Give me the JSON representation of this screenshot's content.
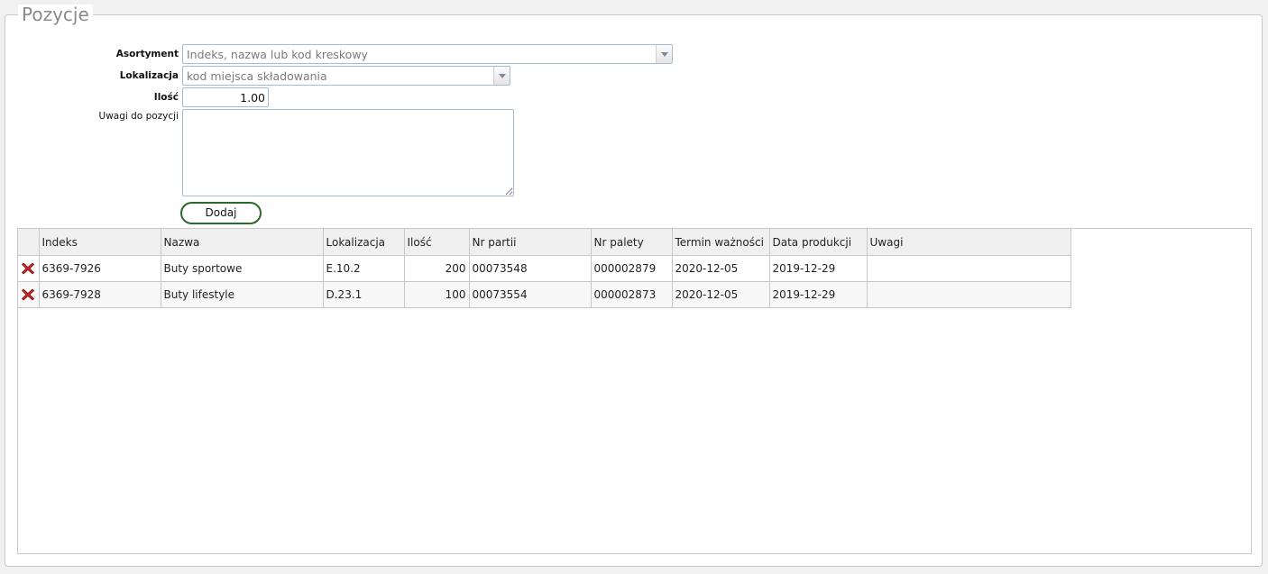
{
  "section": {
    "title": "Pozycje"
  },
  "form": {
    "asortyment_label": "Asortyment",
    "asortyment_placeholder": "Indeks, nazwa lub kod kreskowy",
    "lokalizacja_label": "Lokalizacja",
    "lokalizacja_placeholder": "kod miejsca składowania",
    "ilosc_label": "Ilość",
    "ilosc_value": "1.00",
    "uwagi_label": "Uwagi do pozycji",
    "add_button": "Dodaj"
  },
  "table": {
    "columns": [
      "Indeks",
      "Nazwa",
      "Lokalizacja",
      "Ilość",
      "Nr partii",
      "Nr palety",
      "Termin ważności",
      "Data produkcji",
      "Uwagi"
    ],
    "rows": [
      {
        "indeks": "6369-7926",
        "nazwa": "Buty sportowe",
        "lokalizacja": "E.10.2",
        "ilosc": "200",
        "nr_partii": "00073548",
        "nr_palety": "000002879",
        "termin": "2020-12-05",
        "data_produkcji": "2019-12-29",
        "uwagi": ""
      },
      {
        "indeks": "6369-7928",
        "nazwa": "Buty lifestyle",
        "lokalizacja": "D.23.1",
        "ilosc": "100",
        "nr_partii": "00073554",
        "nr_palety": "000002873",
        "termin": "2020-12-05",
        "data_produkcji": "2019-12-29",
        "uwagi": ""
      }
    ]
  },
  "icons": {
    "delete": "delete-x-icon"
  },
  "colors": {
    "delete_icon": "#c62828",
    "button_border": "#2b6a2b",
    "field_border": "#a9bcd2"
  }
}
